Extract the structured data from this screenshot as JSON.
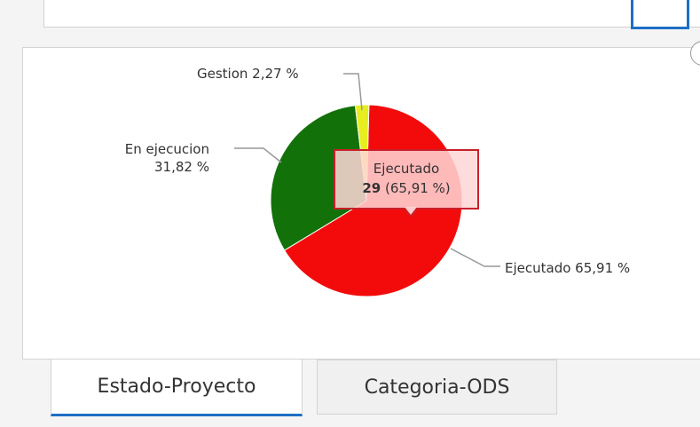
{
  "chart_data": {
    "type": "pie",
    "slices": [
      {
        "label": "Ejecutado",
        "count": 29,
        "percent": 65.91,
        "percent_text": "65,91 %",
        "color": "#f30b0b"
      },
      {
        "label": "En ejecucion",
        "percent": 31.82,
        "percent_text": "31,82 %",
        "color": "#127109"
      },
      {
        "label": "Gestion",
        "percent": 2.27,
        "percent_text": "2,27 %",
        "color": "#e7ee1f"
      }
    ]
  },
  "labels": {
    "gestion": "Gestion 2,27 %",
    "en_ejecucion_line1": "En ejecucion",
    "en_ejecucion_line2": "31,82 %",
    "ejecutado": "Ejecutado 65,91 %"
  },
  "tooltip": {
    "title": "Ejecutado",
    "value": "29",
    "percent": "(65,91 %)"
  },
  "tabs": [
    {
      "label": "Estado-Proyecto",
      "active": true
    },
    {
      "label": "Categoria-ODS",
      "active": false
    }
  ],
  "colors": {
    "accent": "#1e6fc4",
    "tooltip_border": "#c8202a",
    "leader_line": "#999999"
  }
}
